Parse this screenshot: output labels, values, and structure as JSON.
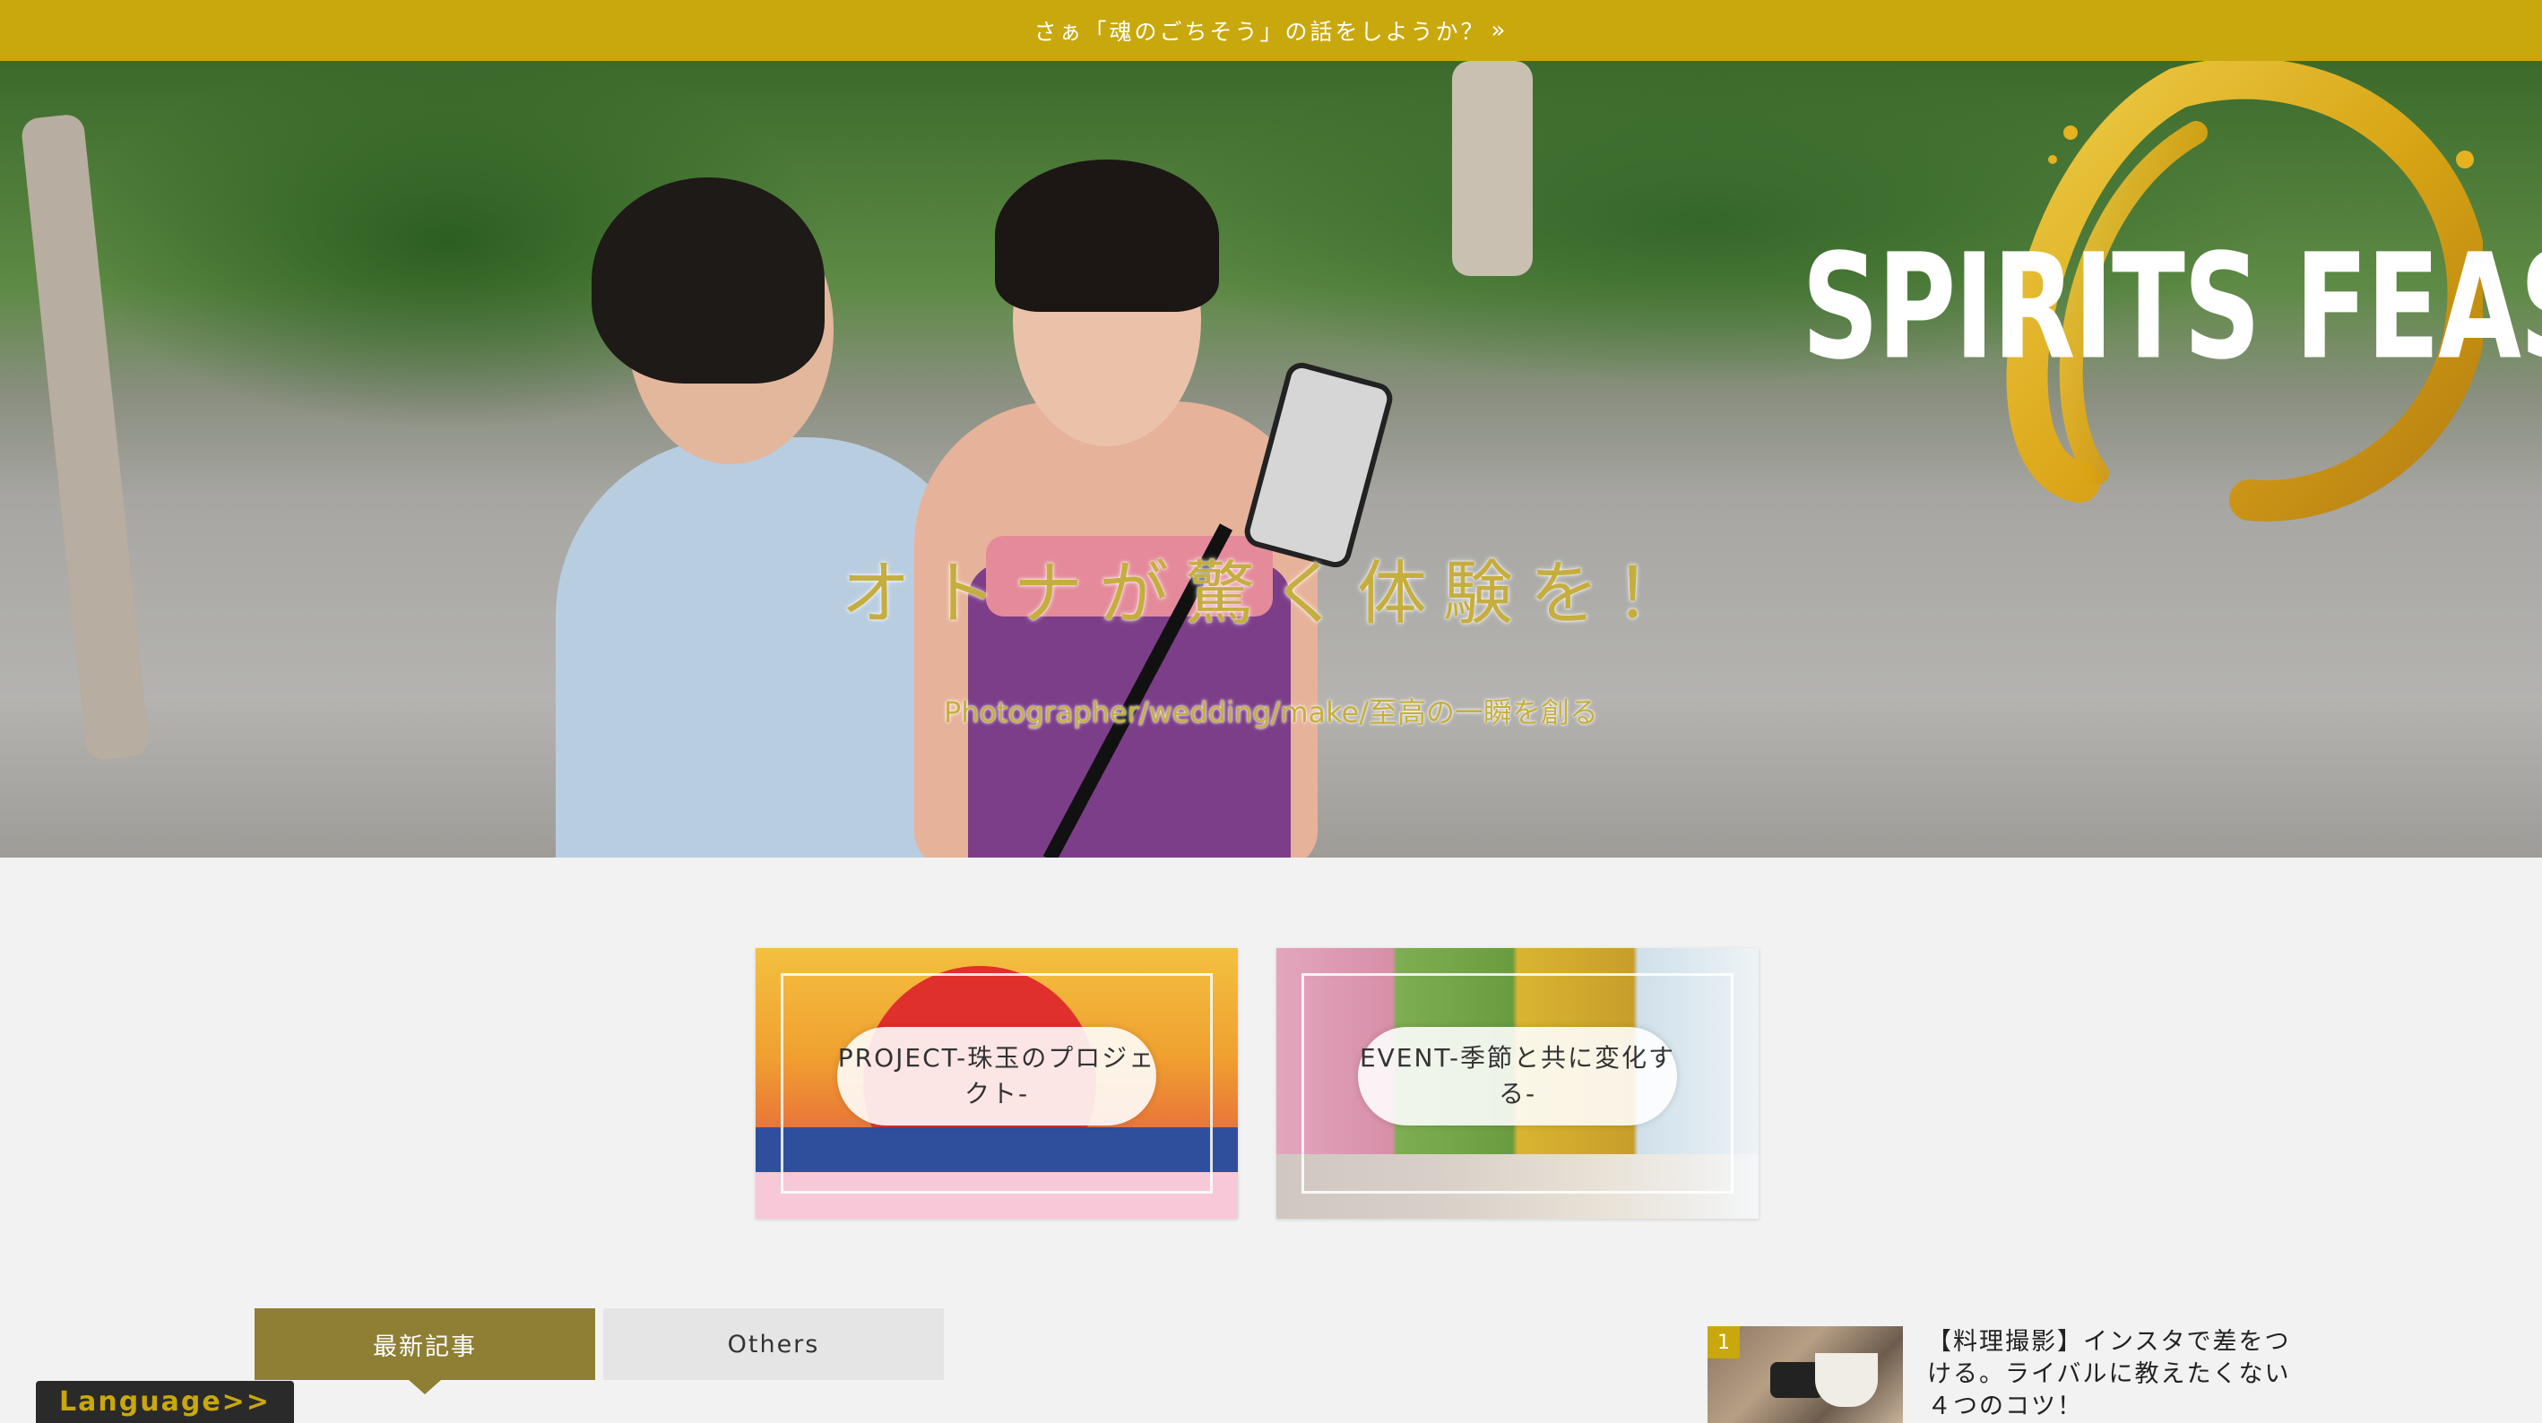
{
  "topbar": {
    "text": "さぁ「魂のごちそう」の話をしようか？",
    "chevron": "»"
  },
  "hero": {
    "logo": "SPIRITS FEAST",
    "title": "オトナが驚く体験を！",
    "subtitle": "Photographer/wedding/make/至高の一瞬を創る"
  },
  "cards": [
    {
      "label": "PROJECT-珠玉のプロジェクト-"
    },
    {
      "label": "EVENT-季節と共に変化する-"
    }
  ],
  "tabs": {
    "latest": "最新記事",
    "others": "Others"
  },
  "language_button": "Language>>",
  "ranking": [
    {
      "rank": "1",
      "title": "【料理撮影】インスタで差をつける。ライバルに教えたくない４つのコツ！"
    }
  ],
  "colors": {
    "accent": "#c8a80c",
    "tab_active": "#8e7f34",
    "title_gold": "#c5ae3f"
  }
}
